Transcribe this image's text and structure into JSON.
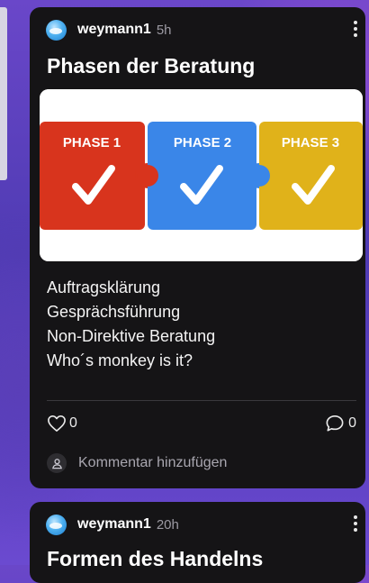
{
  "posts": [
    {
      "author": "weymann1",
      "time": "5h",
      "title": "Phasen der Beratung",
      "image": {
        "phases": [
          "PHASE 1",
          "PHASE 2",
          "PHASE 3"
        ],
        "phase_colors": [
          "#d8341d",
          "#3a86e8",
          "#e0b21a"
        ]
      },
      "lines": [
        "Auftragsklärung",
        "Gesprächsführung",
        "Non-Direktive Beratung",
        "Who´s monkey is it?"
      ],
      "likes": "0",
      "comments": "0",
      "add_comment_placeholder": "Kommentar hinzufügen"
    },
    {
      "author": "weymann1",
      "time": "20h",
      "title": "Formen des Handelns"
    }
  ]
}
